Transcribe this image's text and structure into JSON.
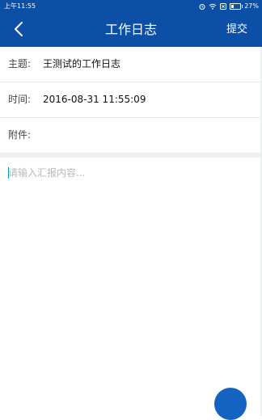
{
  "status_bar": {
    "time": "上午11:55",
    "battery_percent": "27%",
    "battery_level": 0.27
  },
  "header": {
    "title": "工作日志",
    "submit_label": "提交",
    "background_color": "#0c4fa6"
  },
  "form": {
    "subject": {
      "label": "主题:",
      "value": "王测试的工作日志"
    },
    "time": {
      "label": "时间:",
      "value": "2016-08-31 11:55:09"
    },
    "attachment": {
      "label": "附件:"
    }
  },
  "report": {
    "placeholder": "请输入汇报内容...",
    "value": ""
  },
  "icons": {
    "back": "chevron-left-icon",
    "alarm": "alarm-icon",
    "wifi": "wifi-icon",
    "sim": "sim-icon",
    "battery": "battery-icon",
    "fab": "floating-action-button"
  }
}
